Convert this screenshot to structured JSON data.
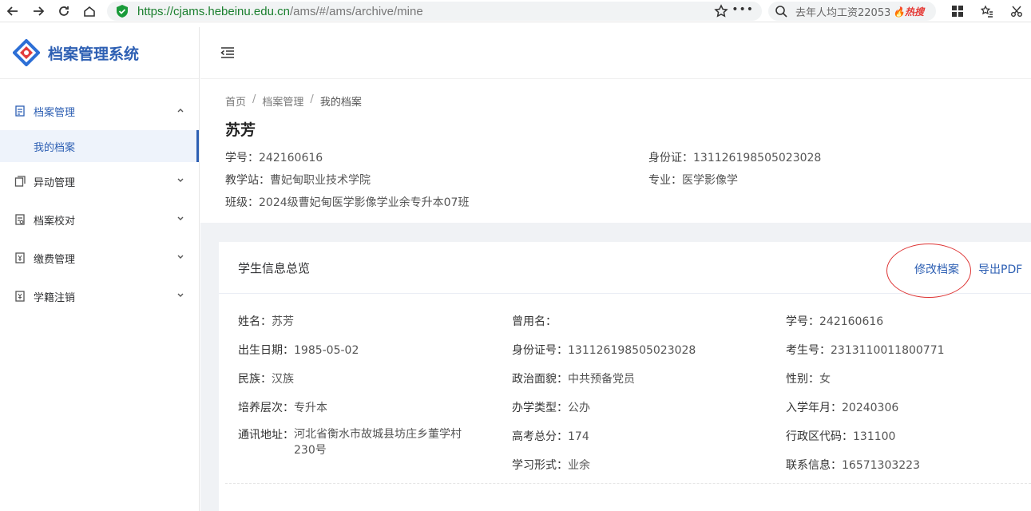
{
  "browser": {
    "url_host": "https://cjams.hebeinu.edu.cn",
    "url_path": "/ams/#/ams/archive/mine",
    "search_text": "去年人均工资22053",
    "hot_badge": "热搜"
  },
  "sidebar": {
    "logo_text": "档案管理系统",
    "items": [
      {
        "label": "档案管理",
        "expanded": true
      },
      {
        "label": "异动管理"
      },
      {
        "label": "档案校对"
      },
      {
        "label": "缴费管理"
      },
      {
        "label": "学籍注销"
      }
    ],
    "submenu": {
      "label": "我的档案"
    }
  },
  "breadcrumb": [
    "首页",
    "档案管理",
    "我的档案"
  ],
  "header": {
    "name": "苏芳",
    "student_id_label": "学号：",
    "student_id": "242160616",
    "id_card_label": "身份证：",
    "id_card": "131126198505023028",
    "station_label": "教学站：",
    "station": "曹妃甸职业技术学院",
    "major_label": "专业：",
    "major": "医学影像学",
    "class_label": "班级：",
    "class": "2024级曹妃甸医学影像学业余专升本07班"
  },
  "card": {
    "title": "学生信息总览",
    "edit_label": "修改档案",
    "pdf_label": "导出PDF",
    "fields": {
      "name": {
        "k": "姓名：",
        "v": "苏芳"
      },
      "former_name": {
        "k": "曾用名：",
        "v": ""
      },
      "sid": {
        "k": "学号：",
        "v": "242160616"
      },
      "birth": {
        "k": "出生日期：",
        "v": "1985-05-02"
      },
      "idno": {
        "k": "身份证号：",
        "v": "131126198505023028"
      },
      "exam_no": {
        "k": "考生号：",
        "v": "2313110011800771"
      },
      "nation": {
        "k": "民族：",
        "v": "汉族"
      },
      "politics": {
        "k": "政治面貌：",
        "v": "中共预备党员"
      },
      "gender": {
        "k": "性别：",
        "v": "女"
      },
      "level": {
        "k": "培养层次：",
        "v": "专升本"
      },
      "school_type": {
        "k": "办学类型：",
        "v": "公办"
      },
      "enroll": {
        "k": "入学年月：",
        "v": "20240306"
      },
      "address": {
        "k": "通讯地址：",
        "v": "河北省衡水市故城县坊庄乡董学村230号"
      },
      "score": {
        "k": "高考总分：",
        "v": "174"
      },
      "region": {
        "k": "行政区代码：",
        "v": "131100"
      },
      "study_form": {
        "k": "学习形式：",
        "v": "业余"
      },
      "contact": {
        "k": "联系信息：",
        "v": "16571303223"
      }
    }
  }
}
